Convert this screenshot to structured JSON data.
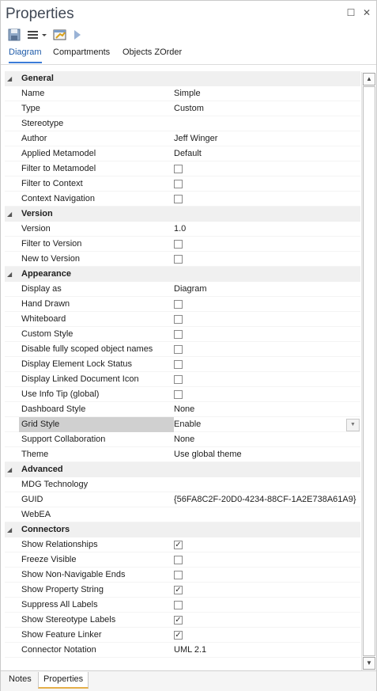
{
  "window": {
    "title": "Properties",
    "restore_glyph": "☐",
    "close_glyph": "✕"
  },
  "toolbar": {
    "icons": [
      "save-icon",
      "menu-icon",
      "dropdown-icon",
      "properties-icon",
      "play-icon"
    ]
  },
  "tabs": [
    {
      "label": "Diagram",
      "active": true
    },
    {
      "label": "Compartments",
      "active": false
    },
    {
      "label": "Objects ZOrder",
      "active": false
    }
  ],
  "grid": {
    "categories": [
      {
        "label": "General",
        "props": [
          {
            "name": "Name",
            "value": "Simple"
          },
          {
            "name": "Type",
            "value": "Custom"
          },
          {
            "name": "Stereotype",
            "value": ""
          },
          {
            "name": "Author",
            "value": "Jeff Winger"
          },
          {
            "name": "Applied Metamodel",
            "value": "Default"
          },
          {
            "name": "Filter to Metamodel",
            "checkbox": false
          },
          {
            "name": "Filter to Context",
            "checkbox": false
          },
          {
            "name": "Context Navigation",
            "checkbox": false
          }
        ]
      },
      {
        "label": "Version",
        "props": [
          {
            "name": "Version",
            "value": "1.0"
          },
          {
            "name": "Filter to Version",
            "checkbox": false
          },
          {
            "name": "New to Version",
            "checkbox": false
          }
        ]
      },
      {
        "label": "Appearance",
        "props": [
          {
            "name": "Display as",
            "value": "Diagram"
          },
          {
            "name": "Hand Drawn",
            "checkbox": false
          },
          {
            "name": "Whiteboard",
            "checkbox": false
          },
          {
            "name": "Custom Style",
            "checkbox": false
          },
          {
            "name": "Disable fully scoped object names",
            "checkbox": false
          },
          {
            "name": "Display Element Lock Status",
            "checkbox": false
          },
          {
            "name": "Display Linked Document Icon",
            "checkbox": false
          },
          {
            "name": "Use Info Tip (global)",
            "checkbox": false
          },
          {
            "name": "Dashboard Style",
            "value": "None"
          },
          {
            "name": "Grid Style",
            "value": "Enable",
            "selected": true,
            "dropdown": true
          },
          {
            "name": "Support Collaboration",
            "value": "None"
          },
          {
            "name": "Theme",
            "value": "Use global theme"
          }
        ]
      },
      {
        "label": "Advanced",
        "props": [
          {
            "name": "MDG Technology",
            "value": ""
          },
          {
            "name": "GUID",
            "value": "{56FA8C2F-20D0-4234-88CF-1A2E738A61A9}"
          },
          {
            "name": "WebEA",
            "value": ""
          }
        ]
      },
      {
        "label": "Connectors",
        "props": [
          {
            "name": "Show Relationships",
            "checkbox": true
          },
          {
            "name": "Freeze Visible",
            "checkbox": false
          },
          {
            "name": "Show Non-Navigable Ends",
            "checkbox": false
          },
          {
            "name": "Show Property String",
            "checkbox": true
          },
          {
            "name": "Suppress All Labels",
            "checkbox": false
          },
          {
            "name": "Show Stereotype Labels",
            "checkbox": true
          },
          {
            "name": "Show Feature Linker",
            "checkbox": true
          },
          {
            "name": "Connector Notation",
            "value": "UML 2.1"
          }
        ]
      }
    ]
  },
  "glyphs": {
    "expanded": "◢",
    "check": "✓",
    "dropdown": "▼",
    "scroll_up": "▲",
    "scroll_down": "▼"
  },
  "bottom_tabs": [
    {
      "label": "Notes",
      "active": false
    },
    {
      "label": "Properties",
      "active": true
    }
  ]
}
